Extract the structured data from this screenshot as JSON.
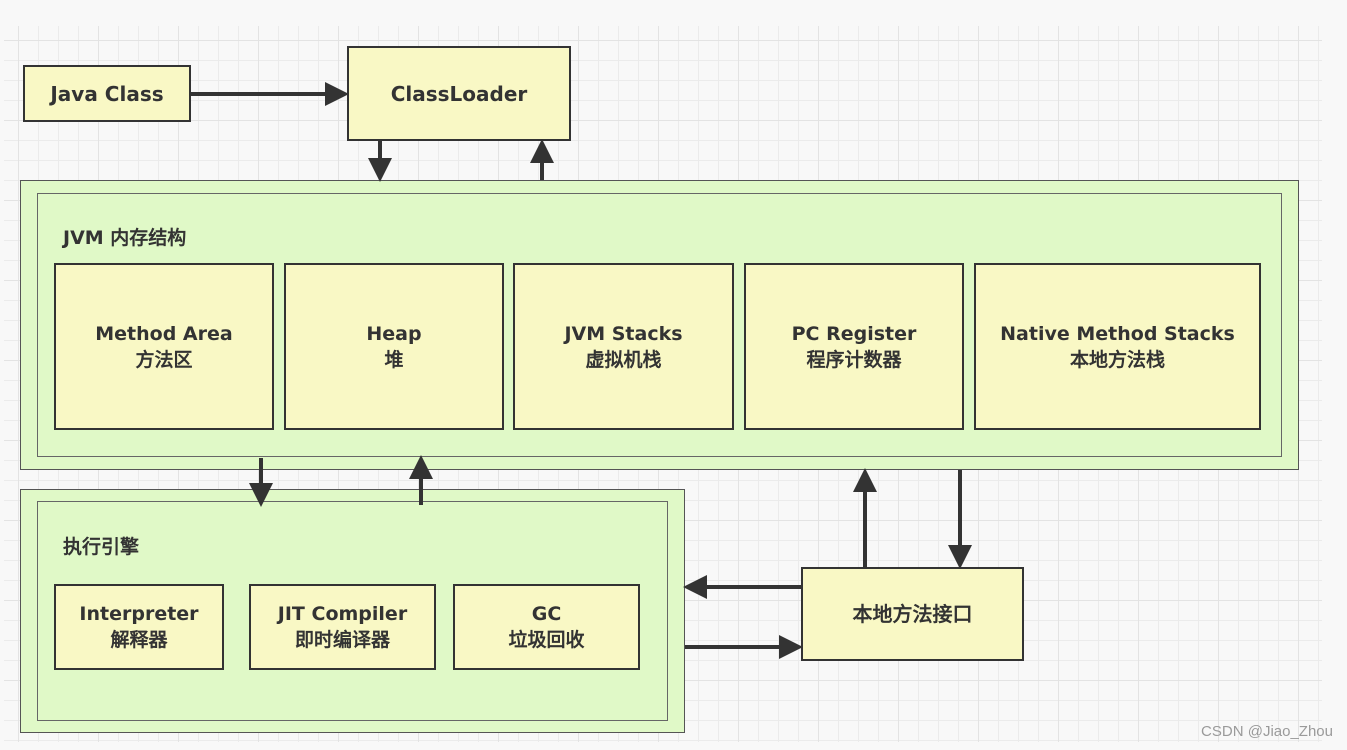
{
  "diagram": {
    "java_class": "Java Class",
    "class_loader": "ClassLoader",
    "jvm_memory": {
      "title": "JVM 内存结构",
      "areas": [
        {
          "en": "Method Area",
          "zh": "方法区"
        },
        {
          "en": "Heap",
          "zh": "堆"
        },
        {
          "en": "JVM Stacks",
          "zh": "虚拟机栈"
        },
        {
          "en": "PC Register",
          "zh": "程序计数器"
        },
        {
          "en": "Native Method Stacks",
          "zh": "本地方法栈"
        }
      ]
    },
    "execution_engine": {
      "title": "执行引擎",
      "components": [
        {
          "en": "Interpreter",
          "zh": "解释器"
        },
        {
          "en": "JIT Compiler",
          "zh": "即时编译器"
        },
        {
          "en": "GC",
          "zh": "垃圾回收"
        }
      ]
    },
    "native_interface": "本地方法接口",
    "edges": [
      {
        "from": "Java Class",
        "to": "ClassLoader"
      },
      {
        "from": "ClassLoader",
        "to": "JVM 内存结构"
      },
      {
        "from": "JVM 内存结构",
        "to": "ClassLoader"
      },
      {
        "from": "JVM 内存结构",
        "to": "执行引擎"
      },
      {
        "from": "执行引擎",
        "to": "JVM 内存结构"
      },
      {
        "from": "本地方法接口",
        "to": "JVM 内存结构"
      },
      {
        "from": "JVM 内存结构",
        "to": "本地方法接口"
      },
      {
        "from": "本地方法接口",
        "to": "执行引擎"
      },
      {
        "from": "执行引擎",
        "to": "本地方法接口"
      }
    ],
    "colors": {
      "node_fill": "#f9f8c5",
      "group_fill": "#e0f9c7",
      "stroke": "#333333"
    }
  },
  "watermark": "CSDN @Jiao_Zhou"
}
